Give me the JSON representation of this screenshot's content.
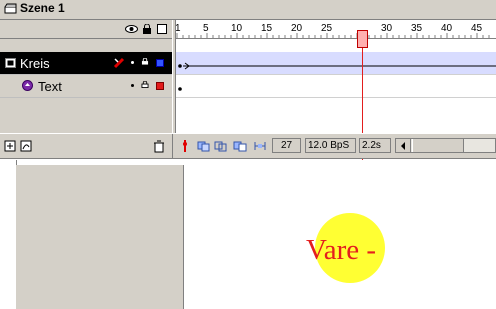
{
  "scene": {
    "name": "Szene 1",
    "icon": "scene-clapper-icon"
  },
  "timeline": {
    "header_icons": [
      "eye-icon",
      "lock-icon",
      "outline-square-icon"
    ],
    "ruler": {
      "ticks": [
        "1",
        "5",
        "10",
        "15",
        "20",
        "25",
        "30",
        "35",
        "40",
        "45"
      ]
    },
    "playhead_frame": 26,
    "layers": [
      {
        "name": "Kreis",
        "selected": true,
        "icon": "layer-icon",
        "edit_icon": "pencil-icon",
        "color": "#3355ff"
      },
      {
        "name": "Text",
        "selected": false,
        "icon": "folder-layer-icon",
        "color": "#e21b1b"
      }
    ],
    "bottom": {
      "current_frame": "27",
      "frame_rate": "12.0 BpS",
      "elapsed": "2.2s"
    }
  },
  "stage": {
    "text": "Vare -",
    "circle_color": "#ffff33",
    "text_color": "#e41e1e"
  }
}
